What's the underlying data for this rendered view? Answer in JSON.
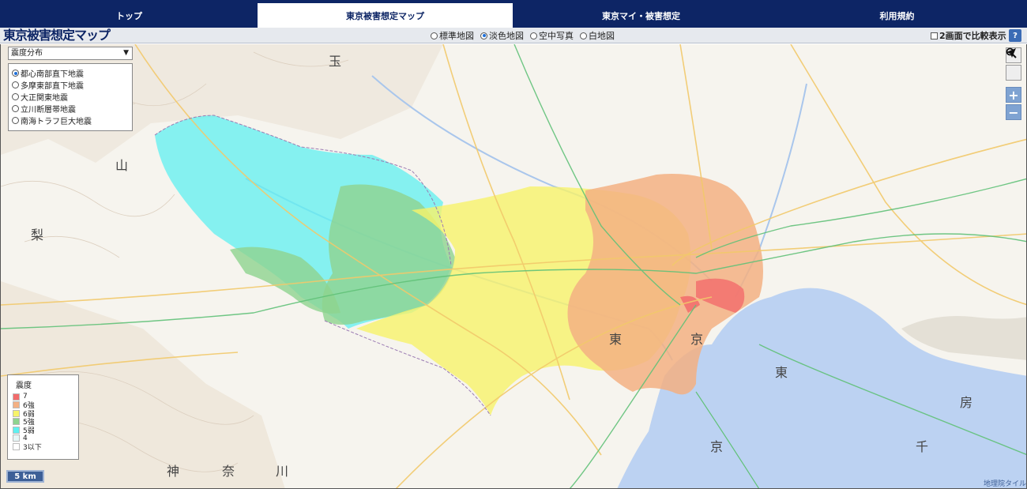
{
  "nav": {
    "tabs": [
      {
        "label": "トップ",
        "active": false
      },
      {
        "label": "東京被害想定マップ",
        "active": true
      },
      {
        "label": "東京マイ・被害想定",
        "active": false
      },
      {
        "label": "利用規約",
        "active": false
      }
    ]
  },
  "header": {
    "logo": "東京被害想定マップ",
    "basemaps": [
      {
        "label": "標準地図",
        "selected": false
      },
      {
        "label": "淡色地図",
        "selected": true
      },
      {
        "label": "空中写真",
        "selected": false
      },
      {
        "label": "白地図",
        "selected": false
      }
    ],
    "compare_label": "2画面で比較表示",
    "help_label": "?"
  },
  "map": {
    "layer_select": "震度分布",
    "scenarios": [
      {
        "label": "都心南部直下地震",
        "selected": true
      },
      {
        "label": "多摩東部直下地震",
        "selected": false
      },
      {
        "label": "大正関東地震",
        "selected": false
      },
      {
        "label": "立川断層帯地震",
        "selected": false
      },
      {
        "label": "南海トラフ巨大地震",
        "selected": false
      }
    ],
    "controls": {
      "zoom_in": "+",
      "zoom_out": "−"
    },
    "legend": {
      "title": "震度",
      "items": [
        {
          "label": "7",
          "color": "#f26b6b"
        },
        {
          "label": "6強",
          "color": "#f3b083"
        },
        {
          "label": "6弱",
          "color": "#f7f36a"
        },
        {
          "label": "5強",
          "color": "#8fd38f"
        },
        {
          "label": "5弱",
          "color": "#5ff0f0"
        },
        {
          "label": "4",
          "color": "#e6f6f6"
        },
        {
          "label": "3以下",
          "color": "#ffffff"
        }
      ]
    },
    "scale": "5 km",
    "attribution": "地理院タイル",
    "place_labels": [
      "玉",
      "梨",
      "東",
      "東",
      "京",
      "京",
      "千",
      "房",
      "神",
      "奈",
      "川",
      "山"
    ],
    "colors": {
      "ocean": "#bcd2f2",
      "road_primary": "#f2c96b",
      "rail_green": "#61c178",
      "nav_bg": "#0d2565"
    }
  }
}
